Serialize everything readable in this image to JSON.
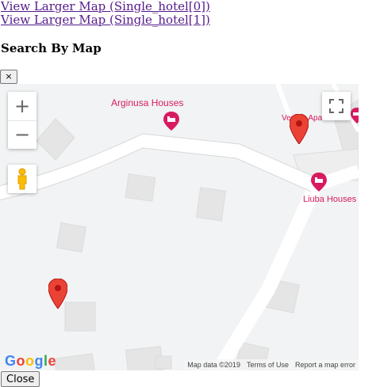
{
  "links": [
    {
      "label": "View Larger Map (Single_hotel[0])"
    },
    {
      "label": "View Larger Map (Single_hotel[1])"
    }
  ],
  "heading": "Search By Map",
  "dismiss_button_label": "×",
  "map": {
    "zoom_in_label": "+",
    "zoom_out_label": "−",
    "pois": [
      {
        "label": "Arginusa Houses"
      },
      {
        "label": "Vergos Apa"
      },
      {
        "label": "Liuba Houses"
      }
    ],
    "logo": {
      "letters": [
        "G",
        "o",
        "o",
        "g",
        "l",
        "e"
      ]
    },
    "attribution": {
      "map_data": "Map data ©2019",
      "terms": "Terms of Use",
      "report": "Report a map error"
    },
    "colors": {
      "poi": "#d81b60",
      "marker": "#ea4335",
      "logo": [
        "#4285f4",
        "#ea4335",
        "#fbbc05",
        "#4285f4",
        "#34a853",
        "#ea4335"
      ]
    }
  },
  "close_button_label": "Close"
}
